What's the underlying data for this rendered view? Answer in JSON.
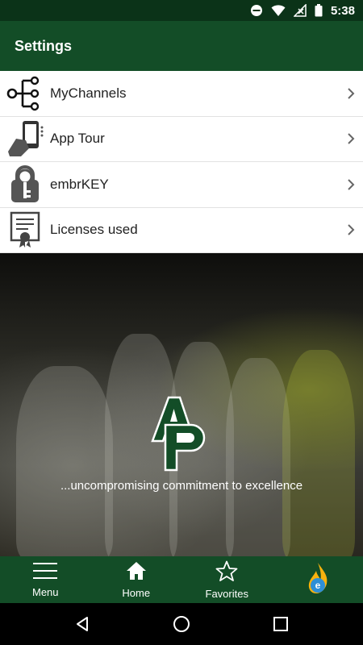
{
  "status_bar": {
    "time": "5:38"
  },
  "app_bar": {
    "title": "Settings"
  },
  "settings_items": [
    {
      "label": "MyChannels",
      "icon": "channels-icon"
    },
    {
      "label": "App Tour",
      "icon": "phone-hand-icon"
    },
    {
      "label": "embrKEY",
      "icon": "lock-key-icon"
    },
    {
      "label": "Licenses used",
      "icon": "certificate-icon"
    }
  ],
  "hero": {
    "tagline": "...uncompromising commitment to excellence"
  },
  "bottom_nav": {
    "menu": "Menu",
    "home": "Home",
    "favorites": "Favorites"
  },
  "colors": {
    "primary": "#134d27",
    "status": "#0b3318"
  }
}
